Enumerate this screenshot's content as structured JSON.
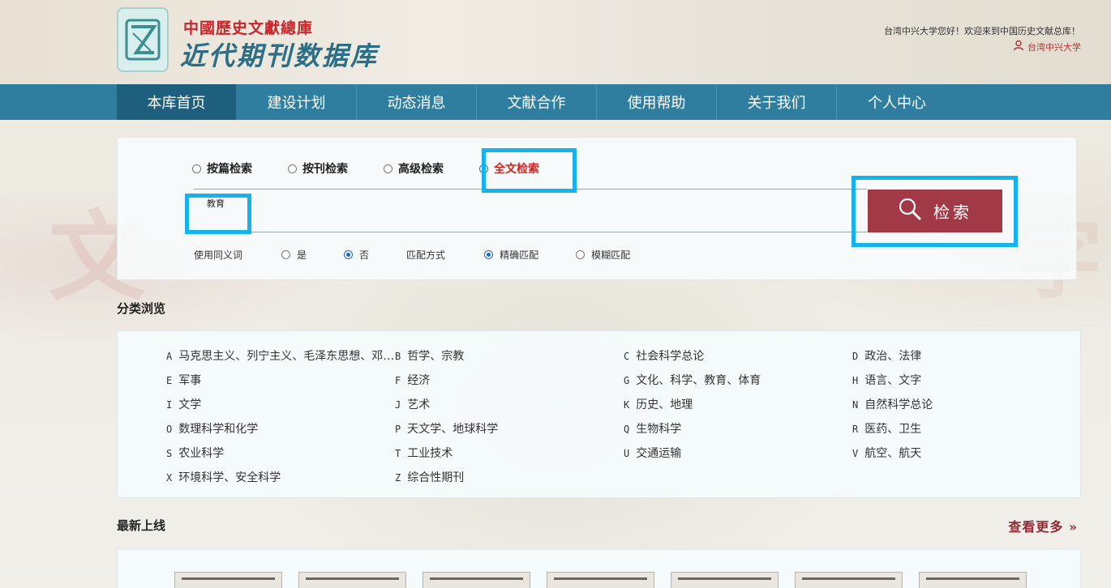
{
  "header": {
    "logo_line1": "中國歷史文獻總庫",
    "logo_line2": "近代期刊数据库",
    "welcome": "台湾中兴大学您好！欢迎来到中国历史文献总库！",
    "user": "台湾中兴大学"
  },
  "nav": {
    "items": [
      {
        "label": "本库首页"
      },
      {
        "label": "建设计划"
      },
      {
        "label": "动态消息"
      },
      {
        "label": "文献合作"
      },
      {
        "label": "使用帮助"
      },
      {
        "label": "关于我们"
      },
      {
        "label": "个人中心"
      }
    ]
  },
  "search": {
    "modes": [
      {
        "label": "按篇检索"
      },
      {
        "label": "按刊检索"
      },
      {
        "label": "高级检索"
      },
      {
        "label": "全文检索"
      }
    ],
    "query": "教育",
    "button_label": "检索",
    "synonym_label": "使用同义词",
    "synonym_yes": "是",
    "synonym_no": "否",
    "match_label": "匹配方式",
    "match_exact": "精确匹配",
    "match_fuzzy": "模糊匹配"
  },
  "categories": {
    "title": "分类浏览",
    "items": [
      {
        "code": "A",
        "label": "马克思主义、列宁主义、毛泽东思想、邓小平理论"
      },
      {
        "code": "B",
        "label": "哲学、宗教"
      },
      {
        "code": "C",
        "label": "社会科学总论"
      },
      {
        "code": "D",
        "label": "政治、法律"
      },
      {
        "code": "E",
        "label": "军事"
      },
      {
        "code": "F",
        "label": "经济"
      },
      {
        "code": "G",
        "label": "文化、科学、教育、体育"
      },
      {
        "code": "H",
        "label": "语言、文字"
      },
      {
        "code": "I",
        "label": "文学"
      },
      {
        "code": "J",
        "label": "艺术"
      },
      {
        "code": "K",
        "label": "历史、地理"
      },
      {
        "code": "N",
        "label": "自然科学总论"
      },
      {
        "code": "O",
        "label": "数理科学和化学"
      },
      {
        "code": "P",
        "label": "天文学、地球科学"
      },
      {
        "code": "Q",
        "label": "生物科学"
      },
      {
        "code": "R",
        "label": "医药、卫生"
      },
      {
        "code": "S",
        "label": "农业科学"
      },
      {
        "code": "T",
        "label": "工业技术"
      },
      {
        "code": "U",
        "label": "交通运输"
      },
      {
        "code": "V",
        "label": "航空、航天"
      },
      {
        "code": "X",
        "label": "环境科学、安全科学"
      },
      {
        "code": "Z",
        "label": "综合性期刊"
      }
    ]
  },
  "latest": {
    "title": "最新上线",
    "more": "查看更多 »"
  }
}
